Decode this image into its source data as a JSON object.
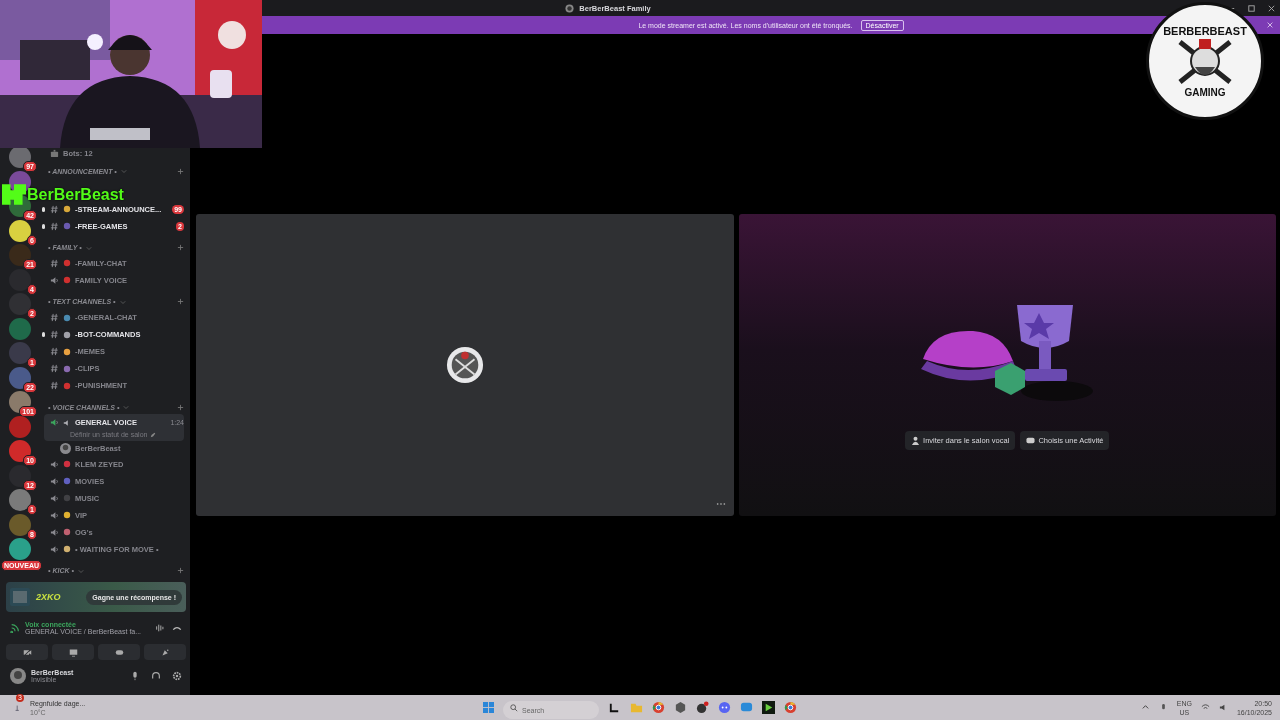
{
  "window": {
    "title": "BerBerBeast Family"
  },
  "banner": {
    "text": "Le mode streamer est activé. Les noms d'utilisateur ont été tronqués.",
    "button": "Désactiver"
  },
  "overlay": {
    "streamer_name": "BerBerBeast",
    "logo_top": "BERBERBEAST",
    "logo_bottom": "GAMING"
  },
  "servers": [
    {
      "badge": "97",
      "color": "#6b6b70"
    },
    {
      "color": "#7a4a9a"
    },
    {
      "badge": "42",
      "color": "#2f6b3a"
    },
    {
      "badge": "6",
      "color": "#d8d040"
    },
    {
      "badge": "21",
      "color": "#3a2a1a"
    },
    {
      "badge": "4",
      "color": "#2a2a2e"
    },
    {
      "badge": "2",
      "color": "#303034"
    },
    {
      "color": "#1f6a4a"
    },
    {
      "badge": "1",
      "color": "#3a3a4a"
    },
    {
      "badge": "22",
      "color": "#4a5a8a"
    },
    {
      "badge": "101",
      "color": "#8a7a6a"
    },
    {
      "color": "#b02020"
    },
    {
      "badge": "10",
      "color": "#d02a2a"
    },
    {
      "badge": "12",
      "color": "#2a2a2e"
    },
    {
      "badge": "1",
      "color": "#7a7a7a"
    },
    {
      "badge": "8",
      "color": "#6a5a2a"
    },
    {
      "badge": "NOUVEAU",
      "color": "#2aa08a"
    }
  ],
  "channels": [
    {
      "kind": "info",
      "name": "Bots: 12"
    },
    {
      "kind": "category",
      "name": "• ANNOUNCEMENT •"
    },
    {
      "kind": "text",
      "name": "-STREAM-ANNOUNCE...",
      "badge": "99",
      "unread": true,
      "selected": false,
      "color": "#d8a83a"
    },
    {
      "kind": "text",
      "name": "-FREE-GAMES",
      "badge": "2",
      "unread": true,
      "selected": false,
      "color": "#6a5ab0"
    },
    {
      "kind": "category",
      "name": "• FAMILY •"
    },
    {
      "kind": "text",
      "name": "-FAMILY-CHAT",
      "unread": false,
      "selected": false,
      "color": "#d0302f"
    },
    {
      "kind": "voice",
      "name": "FAMILY VOICE",
      "unread": false,
      "selected": false,
      "color": "#d0302f"
    },
    {
      "kind": "category",
      "name": "• TEXT CHANNELS •"
    },
    {
      "kind": "text",
      "name": "-GENERAL-CHAT",
      "unread": false,
      "selected": false,
      "color": "#4a8ab0"
    },
    {
      "kind": "text",
      "name": "-BOT-COMMANDS",
      "unread": true,
      "selected": false,
      "color": "#a0a0a8"
    },
    {
      "kind": "text",
      "name": "-MEMES",
      "unread": false,
      "selected": false,
      "color": "#e8a040"
    },
    {
      "kind": "text",
      "name": "-CLIPS",
      "unread": false,
      "selected": false,
      "color": "#8a6ab0"
    },
    {
      "kind": "text",
      "name": "-PUNISHMENT",
      "unread": false,
      "selected": false,
      "color": "#d03030"
    },
    {
      "kind": "category",
      "name": "• VOICE CHANNELS •"
    },
    {
      "kind": "voice",
      "name": "GENERAL VOICE",
      "unread": true,
      "selected": true,
      "time": "1:24",
      "status": "Définir un statut de salon",
      "members": [
        {
          "name": "BerBerBeast"
        }
      ]
    },
    {
      "kind": "voice",
      "name": "KLEM ZEYED",
      "unread": false,
      "selected": false,
      "color": "#d03040"
    },
    {
      "kind": "voice",
      "name": "MOVIES",
      "unread": false,
      "selected": false,
      "color": "#6060c0"
    },
    {
      "kind": "voice",
      "name": "MUSIC",
      "unread": false,
      "selected": false,
      "color": "#404044"
    },
    {
      "kind": "voice",
      "name": "VIP",
      "unread": false,
      "selected": false,
      "color": "#e0b030"
    },
    {
      "kind": "voice",
      "name": "OG's",
      "unread": false,
      "selected": false,
      "color": "#c06070"
    },
    {
      "kind": "voice",
      "name": "• WAITING FOR MOVE •",
      "unread": false,
      "selected": false,
      "color": "#d0b070"
    },
    {
      "kind": "category",
      "name": "• KICK •"
    }
  ],
  "promo": {
    "logo": "2XKO",
    "button": "Gagne une récompense !"
  },
  "voice": {
    "status": "Voix connectée",
    "channel": "GENERAL VOICE / BerBerBeast fa..."
  },
  "user": {
    "name": "BerBerBeast",
    "status": "Invisible"
  },
  "tiles": [
    {
      "kind": "stream"
    },
    {
      "kind": "activity",
      "buttons": [
        "Inviter dans le salon vocal",
        "Choisis une Activité"
      ]
    }
  ],
  "taskbar": {
    "weather": {
      "badge": "3",
      "title": "Regnfulde dage...",
      "temp": "10°C"
    },
    "search": {
      "placeholder": "Search"
    },
    "apps": [
      {
        "kind": "terminal"
      },
      {
        "kind": "folder"
      },
      {
        "kind": "browser"
      },
      {
        "kind": "cube"
      },
      {
        "kind": "orb"
      },
      {
        "kind": "chat"
      },
      {
        "kind": "messenger"
      },
      {
        "kind": "media"
      },
      {
        "kind": "browser"
      }
    ],
    "lang": "ENG",
    "region": "US",
    "time": "20:50",
    "date": "16/10/2025"
  }
}
